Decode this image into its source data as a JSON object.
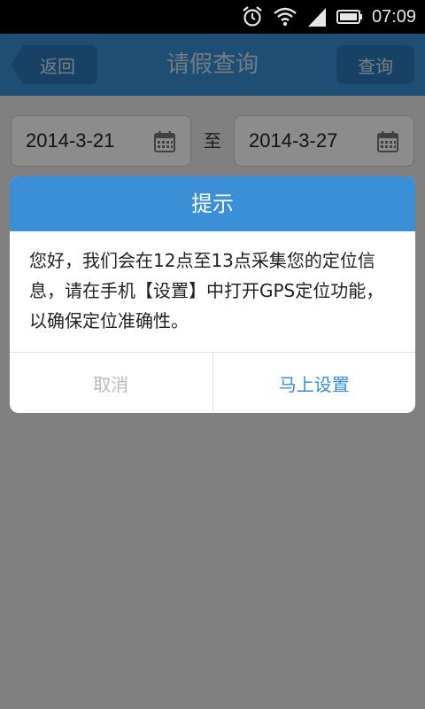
{
  "status_bar": {
    "time": "07:09",
    "icons": [
      "alarm-icon",
      "wifi-icon",
      "signal-icon",
      "battery-icon"
    ]
  },
  "header": {
    "back_label": "返回",
    "title": "请假查询",
    "query_label": "查询"
  },
  "date_range": {
    "start": "2014-3-21",
    "to": "至",
    "end": "2014-3-27"
  },
  "dialog": {
    "title": "提示",
    "message": "您好，我们会在12点至13点采集您的定位信息，请在手机【设置】中打开GPS定位功能，以确保定位准确性。",
    "cancel_label": "取消",
    "confirm_label": "马上设置"
  },
  "colors": {
    "accent": "#3a8fd6",
    "header_button": "#2d78b8",
    "disabled_text": "#b9b9b9"
  }
}
